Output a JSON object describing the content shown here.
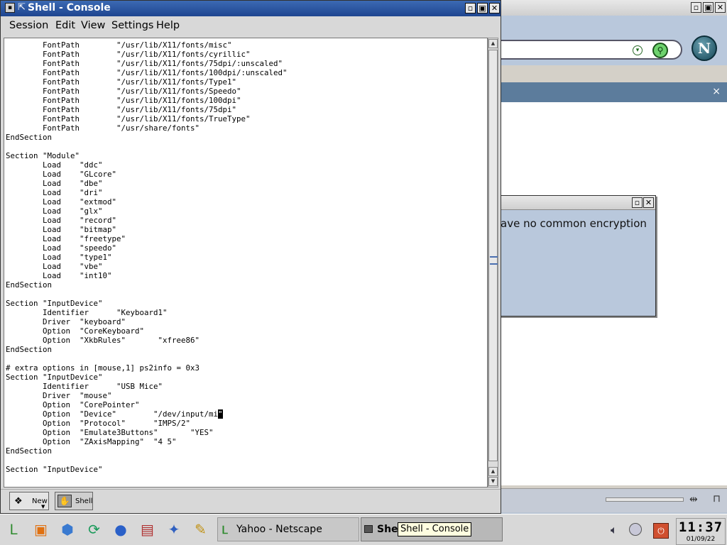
{
  "konsole": {
    "title": "Shell - Console",
    "menu": [
      "Session",
      "Edit",
      "View",
      "Settings",
      "Help"
    ],
    "terminal_lines": [
      "        FontPath        \"/usr/lib/X11/fonts/misc\"",
      "        FontPath        \"/usr/lib/X11/fonts/cyrillic\"",
      "        FontPath        \"/usr/lib/X11/fonts/75dpi/:unscaled\"",
      "        FontPath        \"/usr/lib/X11/fonts/100dpi/:unscaled\"",
      "        FontPath        \"/usr/lib/X11/fonts/Type1\"",
      "        FontPath        \"/usr/lib/X11/fonts/Speedo\"",
      "        FontPath        \"/usr/lib/X11/fonts/100dpi\"",
      "        FontPath        \"/usr/lib/X11/fonts/75dpi\"",
      "        FontPath        \"/usr/lib/X11/fonts/TrueType\"",
      "        FontPath        \"/usr/share/fonts\"",
      "EndSection",
      "",
      "Section \"Module\"",
      "        Load    \"ddc\"",
      "        Load    \"GLcore\"",
      "        Load    \"dbe\"",
      "        Load    \"dri\"",
      "        Load    \"extmod\"",
      "        Load    \"glx\"",
      "        Load    \"record\"",
      "        Load    \"bitmap\"",
      "        Load    \"freetype\"",
      "        Load    \"speedo\"",
      "        Load    \"type1\"",
      "        Load    \"vbe\"",
      "        Load    \"int10\"",
      "EndSection",
      "",
      "Section \"InputDevice\"",
      "        Identifier      \"Keyboard1\"",
      "        Driver  \"keyboard\"",
      "        Option  \"CoreKeyboard\"",
      "        Option  \"XkbRules\"       \"xfree86\"",
      "EndSection",
      "",
      "# extra options in [mouse,1] ps2info = 0x3",
      "Section \"InputDevice\"",
      "        Identifier      \"USB Mice\"",
      "        Driver  \"mouse\"",
      "        Option  \"CorePointer\"",
      "        Option  \"Device\"        \"/dev/input/mi\"",
      "        Option  \"Protocol\"      \"IMPS/2\"",
      "        Option  \"Emulate3Buttons\"       \"YES\"",
      "        Option  \"ZAxisMapping\"  \"4 5\"",
      "EndSection",
      "",
      "Section \"InputDevice\""
    ],
    "cursor_line": 40,
    "tabs": {
      "new_label": "New",
      "shell_label": "Shell"
    },
    "window_buttons": {
      "maximize": "◻",
      "restore": "◻",
      "close": "✕"
    }
  },
  "netscape": {
    "sidebar_close": "×",
    "logo_letter": "N",
    "window_close": "✕"
  },
  "dialog": {
    "message": "ave no common encryption",
    "close": "✕"
  },
  "taskbar": {
    "launchers": [
      {
        "name": "kde-menu-icon",
        "glyph": "Ꮮ",
        "color": "#2c8a2c"
      },
      {
        "name": "lifejacket-icon",
        "glyph": "▣",
        "color": "#e07010"
      },
      {
        "name": "cube-icon",
        "glyph": "⬢",
        "color": "#3a7ad0"
      },
      {
        "name": "runner-icon",
        "glyph": "⟳",
        "color": "#1a9a5a"
      },
      {
        "name": "globe-icon",
        "glyph": "●",
        "color": "#2a60c8"
      },
      {
        "name": "printer-icon",
        "glyph": "▤",
        "color": "#b03030"
      },
      {
        "name": "tools-icon",
        "glyph": "✦",
        "color": "#3060c0"
      },
      {
        "name": "pencil-icon",
        "glyph": "✎",
        "color": "#c09010"
      }
    ],
    "tasks": [
      {
        "label": "Yahoo - Netscape"
      },
      {
        "label": "Shel"
      }
    ],
    "tooltip": "Shell - Console",
    "clock_time": "11:37",
    "clock_date": "01/09/22"
  }
}
